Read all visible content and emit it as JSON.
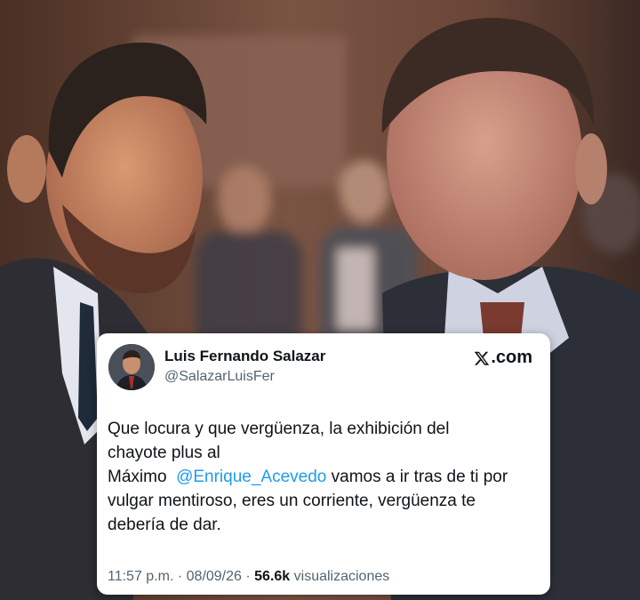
{
  "tweet": {
    "author_name": "Luis Fernando Salazar",
    "author_handle": "@SalazarLuisFer",
    "brand_suffix": ".com",
    "text_lines": [
      "Que locura y que vergüenza, la exhibición del",
      "chayote plus al"
    ],
    "line3_prefix": "Máximo ",
    "mention": "@Enrique_Acevedo",
    "line3_suffix": " vamos a ir tras de ti por",
    "line4": "vulgar mentiroso, eres un corriente, vergüenza te",
    "line5": "debería de dar.",
    "time": "11:57 p.m.",
    "separator": " · ",
    "date": "08/09/26",
    "views_count": "56.6k",
    "views_label": " visualizaciones"
  },
  "icons": {
    "brand_logo": "x-logo-icon"
  },
  "colors": {
    "mention": "#1d9bf0",
    "text": "#0f1419",
    "muted": "#536471"
  }
}
